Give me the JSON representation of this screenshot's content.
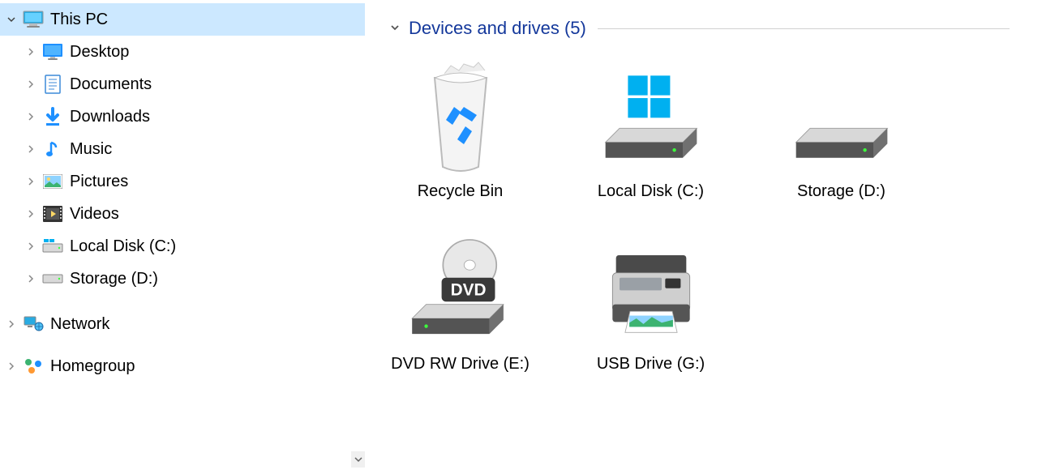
{
  "sidebar": {
    "root": {
      "label": "This PC",
      "expanded": true,
      "children": [
        {
          "label": "Desktop",
          "icon": "desktop"
        },
        {
          "label": "Documents",
          "icon": "documents"
        },
        {
          "label": "Downloads",
          "icon": "downloads"
        },
        {
          "label": "Music",
          "icon": "music"
        },
        {
          "label": "Pictures",
          "icon": "pictures"
        },
        {
          "label": "Videos",
          "icon": "videos"
        },
        {
          "label": "Local Disk (C:)",
          "icon": "drive"
        },
        {
          "label": "Storage (D:)",
          "icon": "drive"
        }
      ]
    },
    "network": {
      "label": "Network"
    },
    "homegroup": {
      "label": "Homegroup"
    }
  },
  "main": {
    "group_label": "Devices and drives (5)",
    "items": [
      {
        "label": "Recycle Bin",
        "icon": "recycle"
      },
      {
        "label": "Local Disk (C:)",
        "icon": "os-drive"
      },
      {
        "label": "Storage (D:)",
        "icon": "hdd"
      },
      {
        "label": "DVD RW Drive (E:)",
        "icon": "dvd"
      },
      {
        "label": "USB Drive (G:)",
        "icon": "printer"
      }
    ]
  }
}
